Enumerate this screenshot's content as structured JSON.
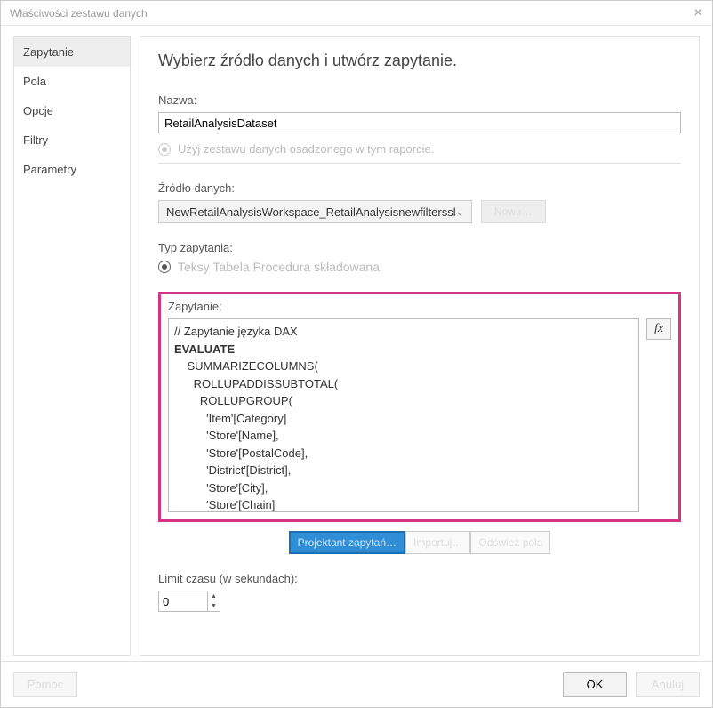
{
  "titlebar": {
    "title": "Właściwości zestawu danych"
  },
  "sidebar": {
    "items": [
      {
        "label": "Zapytanie"
      },
      {
        "label": "Pola"
      },
      {
        "label": "Opcje"
      },
      {
        "label": "Filtry"
      },
      {
        "label": "Parametry"
      }
    ]
  },
  "content": {
    "heading": "Wybierz źródło danych i utwórz zapytanie.",
    "name_label": "Nazwa:",
    "name_value": "RetailAnalysisDataset",
    "embedded_radio": "Użyj zestawu danych osadzonego w tym raporcie.",
    "datasource_label": "Źródło danych:",
    "datasource_value": "NewRetailAnalysisWorkspace_RetailAnalysisnewfilterssl",
    "new_button": "Nowe…",
    "query_type_label": "Typ zapytania:",
    "query_type_text": "Teksy Tabela Procedura składowana",
    "query_label": "Zapytanie:",
    "query_text_html": "// Zapytanie języka DAX\n<strong>EVALUATE</strong>\n    SUMMARIZECOLUMNS(\n      ROLLUPADDISSUBTOTAL(\n        ROLLUPGROUP(\n          'Item'[Category]\n          'Store'[Name],\n          'Store'[PostalCode],\n          'District'[District],\n          'Store'[City],\n          'Store'[Chain]\n        ), \"IsGrandTotalRowTotal\"\n      ),\n      \"This_Year_Sales\", 'Sales'[This Year Sales]",
    "fx_label": "fx",
    "buttons": {
      "designer": "Projektant zapytań…",
      "import": "Importuj…",
      "refresh": "Odśwież pola"
    },
    "timeout_label": "Limit czasu (w sekundach):",
    "timeout_value": "0"
  },
  "footer": {
    "help": "Pomoc",
    "ok": "OK",
    "cancel": "Anuluj"
  }
}
